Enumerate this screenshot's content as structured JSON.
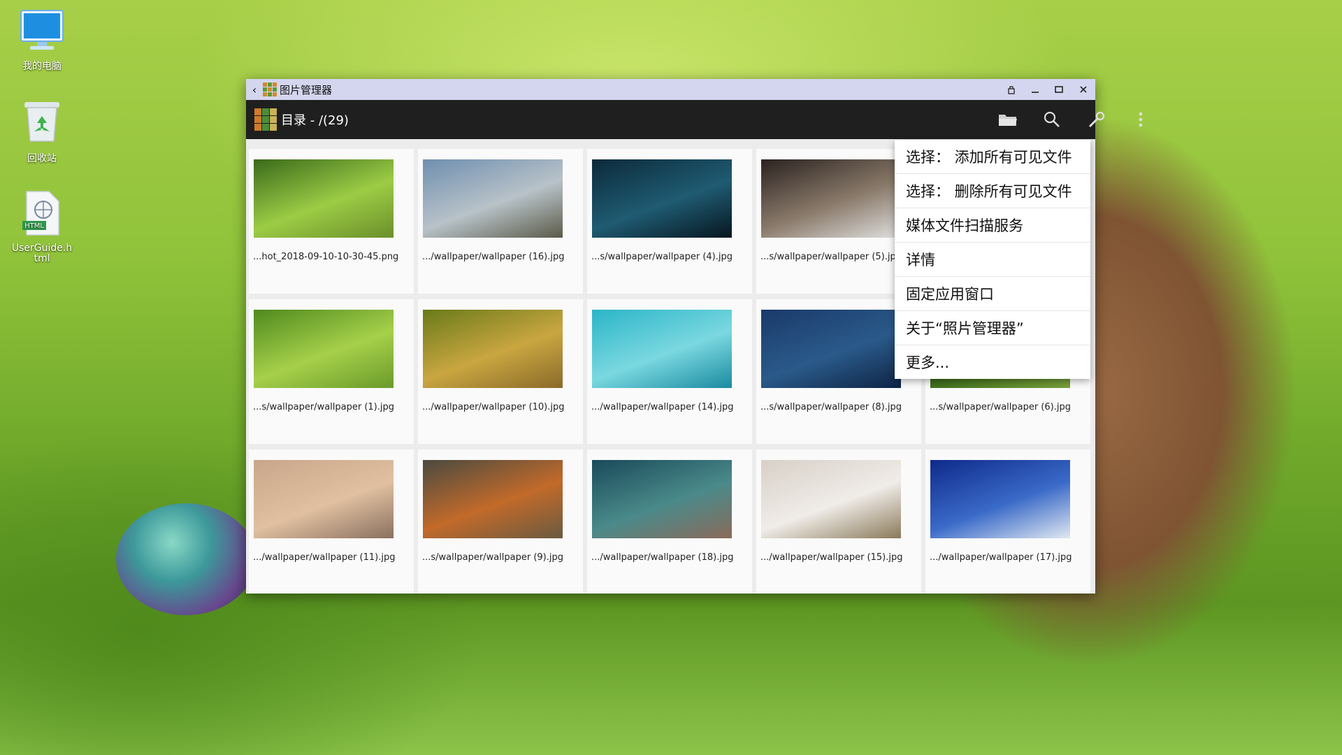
{
  "desktop": {
    "icons": [
      {
        "label": "我的电脑",
        "icon": "computer-icon"
      },
      {
        "label": "回收站",
        "icon": "recycle-bin-icon"
      },
      {
        "label": "UserGuide.html",
        "icon": "html-file-icon"
      }
    ]
  },
  "window": {
    "title": "图片管理器",
    "controls": [
      "pin-icon",
      "minimize-icon",
      "maximize-icon",
      "close-icon"
    ],
    "toolbar": {
      "title": "目录 - /(29)",
      "buttons": [
        "folder-icon",
        "search-icon",
        "wrench-icon",
        "more-vert-icon"
      ]
    }
  },
  "images": [
    {
      "caption": "...hot_2018-09-10-10-30-45.png",
      "colors": [
        "#3a6a1a",
        "#9ccc45",
        "#6b8f2a"
      ]
    },
    {
      "caption": ".../wallpaper/wallpaper (16).jpg",
      "colors": [
        "#6f8fb0",
        "#b8c2c8",
        "#5a5a48"
      ]
    },
    {
      "caption": "...s/wallpaper/wallpaper (4).jpg",
      "colors": [
        "#0c2a3a",
        "#1f5b72",
        "#07161f"
      ]
    },
    {
      "caption": "...s/wallpaper/wallpaper (5).jpg",
      "colors": [
        "#2a2220",
        "#8a7a6a",
        "#e0e0e0"
      ]
    },
    {
      "caption": "",
      "colors": [
        "#ffffff",
        "#ffffff",
        "#ffffff"
      ]
    },
    {
      "caption": "...s/wallpaper/wallpaper (1).jpg",
      "colors": [
        "#4f8a1e",
        "#a6d04a",
        "#6a9a2a"
      ]
    },
    {
      "caption": ".../wallpaper/wallpaper (10).jpg",
      "colors": [
        "#6a7a1a",
        "#c9a640",
        "#8a6a2a"
      ]
    },
    {
      "caption": ".../wallpaper/wallpaper (14).jpg",
      "colors": [
        "#2bb5c8",
        "#7ad8e0",
        "#1a8aa0"
      ]
    },
    {
      "caption": "...s/wallpaper/wallpaper (8).jpg",
      "colors": [
        "#1a3a6a",
        "#2a5a8a",
        "#0e2444"
      ]
    },
    {
      "caption": "...s/wallpaper/wallpaper (6).jpg",
      "colors": [
        "#5a8a2a",
        "#3a6a1a",
        "#7aa03a"
      ]
    },
    {
      "caption": ".../wallpaper/wallpaper (11).jpg",
      "colors": [
        "#c9a68a",
        "#e0c0a0",
        "#8a7060"
      ]
    },
    {
      "caption": "...s/wallpaper/wallpaper (9).jpg",
      "colors": [
        "#4a4a40",
        "#c26a2a",
        "#6a5a40"
      ]
    },
    {
      "caption": ".../wallpaper/wallpaper (18).jpg",
      "colors": [
        "#1a4a5a",
        "#4a8a8a",
        "#8a6a5a"
      ]
    },
    {
      "caption": ".../wallpaper/wallpaper (15).jpg",
      "colors": [
        "#d8d0c8",
        "#f0ece8",
        "#8a7a5a"
      ]
    },
    {
      "caption": ".../wallpaper/wallpaper (17).jpg",
      "colors": [
        "#0e2a8a",
        "#3a6ac8",
        "#e0e8f0"
      ]
    }
  ],
  "menu": {
    "items": [
      "选择： 添加所有可见文件",
      "选择： 删除所有可见文件",
      "媒体文件扫描服务",
      "详情",
      "固定应用窗口",
      "关于“照片管理器”",
      "更多..."
    ]
  }
}
